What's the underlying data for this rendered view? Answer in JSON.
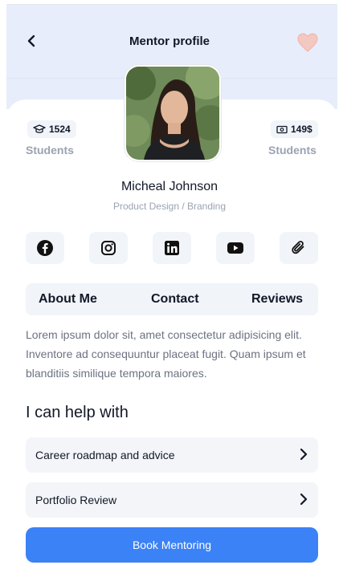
{
  "header": {
    "title": "Mentor profile",
    "back_icon": "chevron-left-icon",
    "favorite_icon": "heart-icon"
  },
  "stats": {
    "left": {
      "icon": "graduation-cap-icon",
      "value": "1524",
      "label": "Students"
    },
    "right": {
      "icon": "cash-icon",
      "value": "149$",
      "label": "Students"
    }
  },
  "profile": {
    "name": "Micheal Johnson",
    "role": "Product Design / Branding"
  },
  "social": [
    "facebook-icon",
    "instagram-icon",
    "linkedin-icon",
    "youtube-icon",
    "paperclip-icon"
  ],
  "tabs": [
    "About Me",
    "Contact",
    "Reviews"
  ],
  "about": "Lorem ipsum dolor sit, amet consectetur adipisicing elit. Inventore ad consequuntur placeat fugit. Quam ipsum et blanditiis similique tempora maiores.",
  "help": {
    "title": "I can help with",
    "items": [
      "Career roadmap and advice",
      "Portfolio Review"
    ]
  },
  "cta": {
    "label": "Book Mentoring"
  },
  "colors": {
    "header_bg": "#e8edfb",
    "accent": "#3b82f6",
    "heart": "#f3c8c0",
    "muted": "#9aa3b2"
  }
}
